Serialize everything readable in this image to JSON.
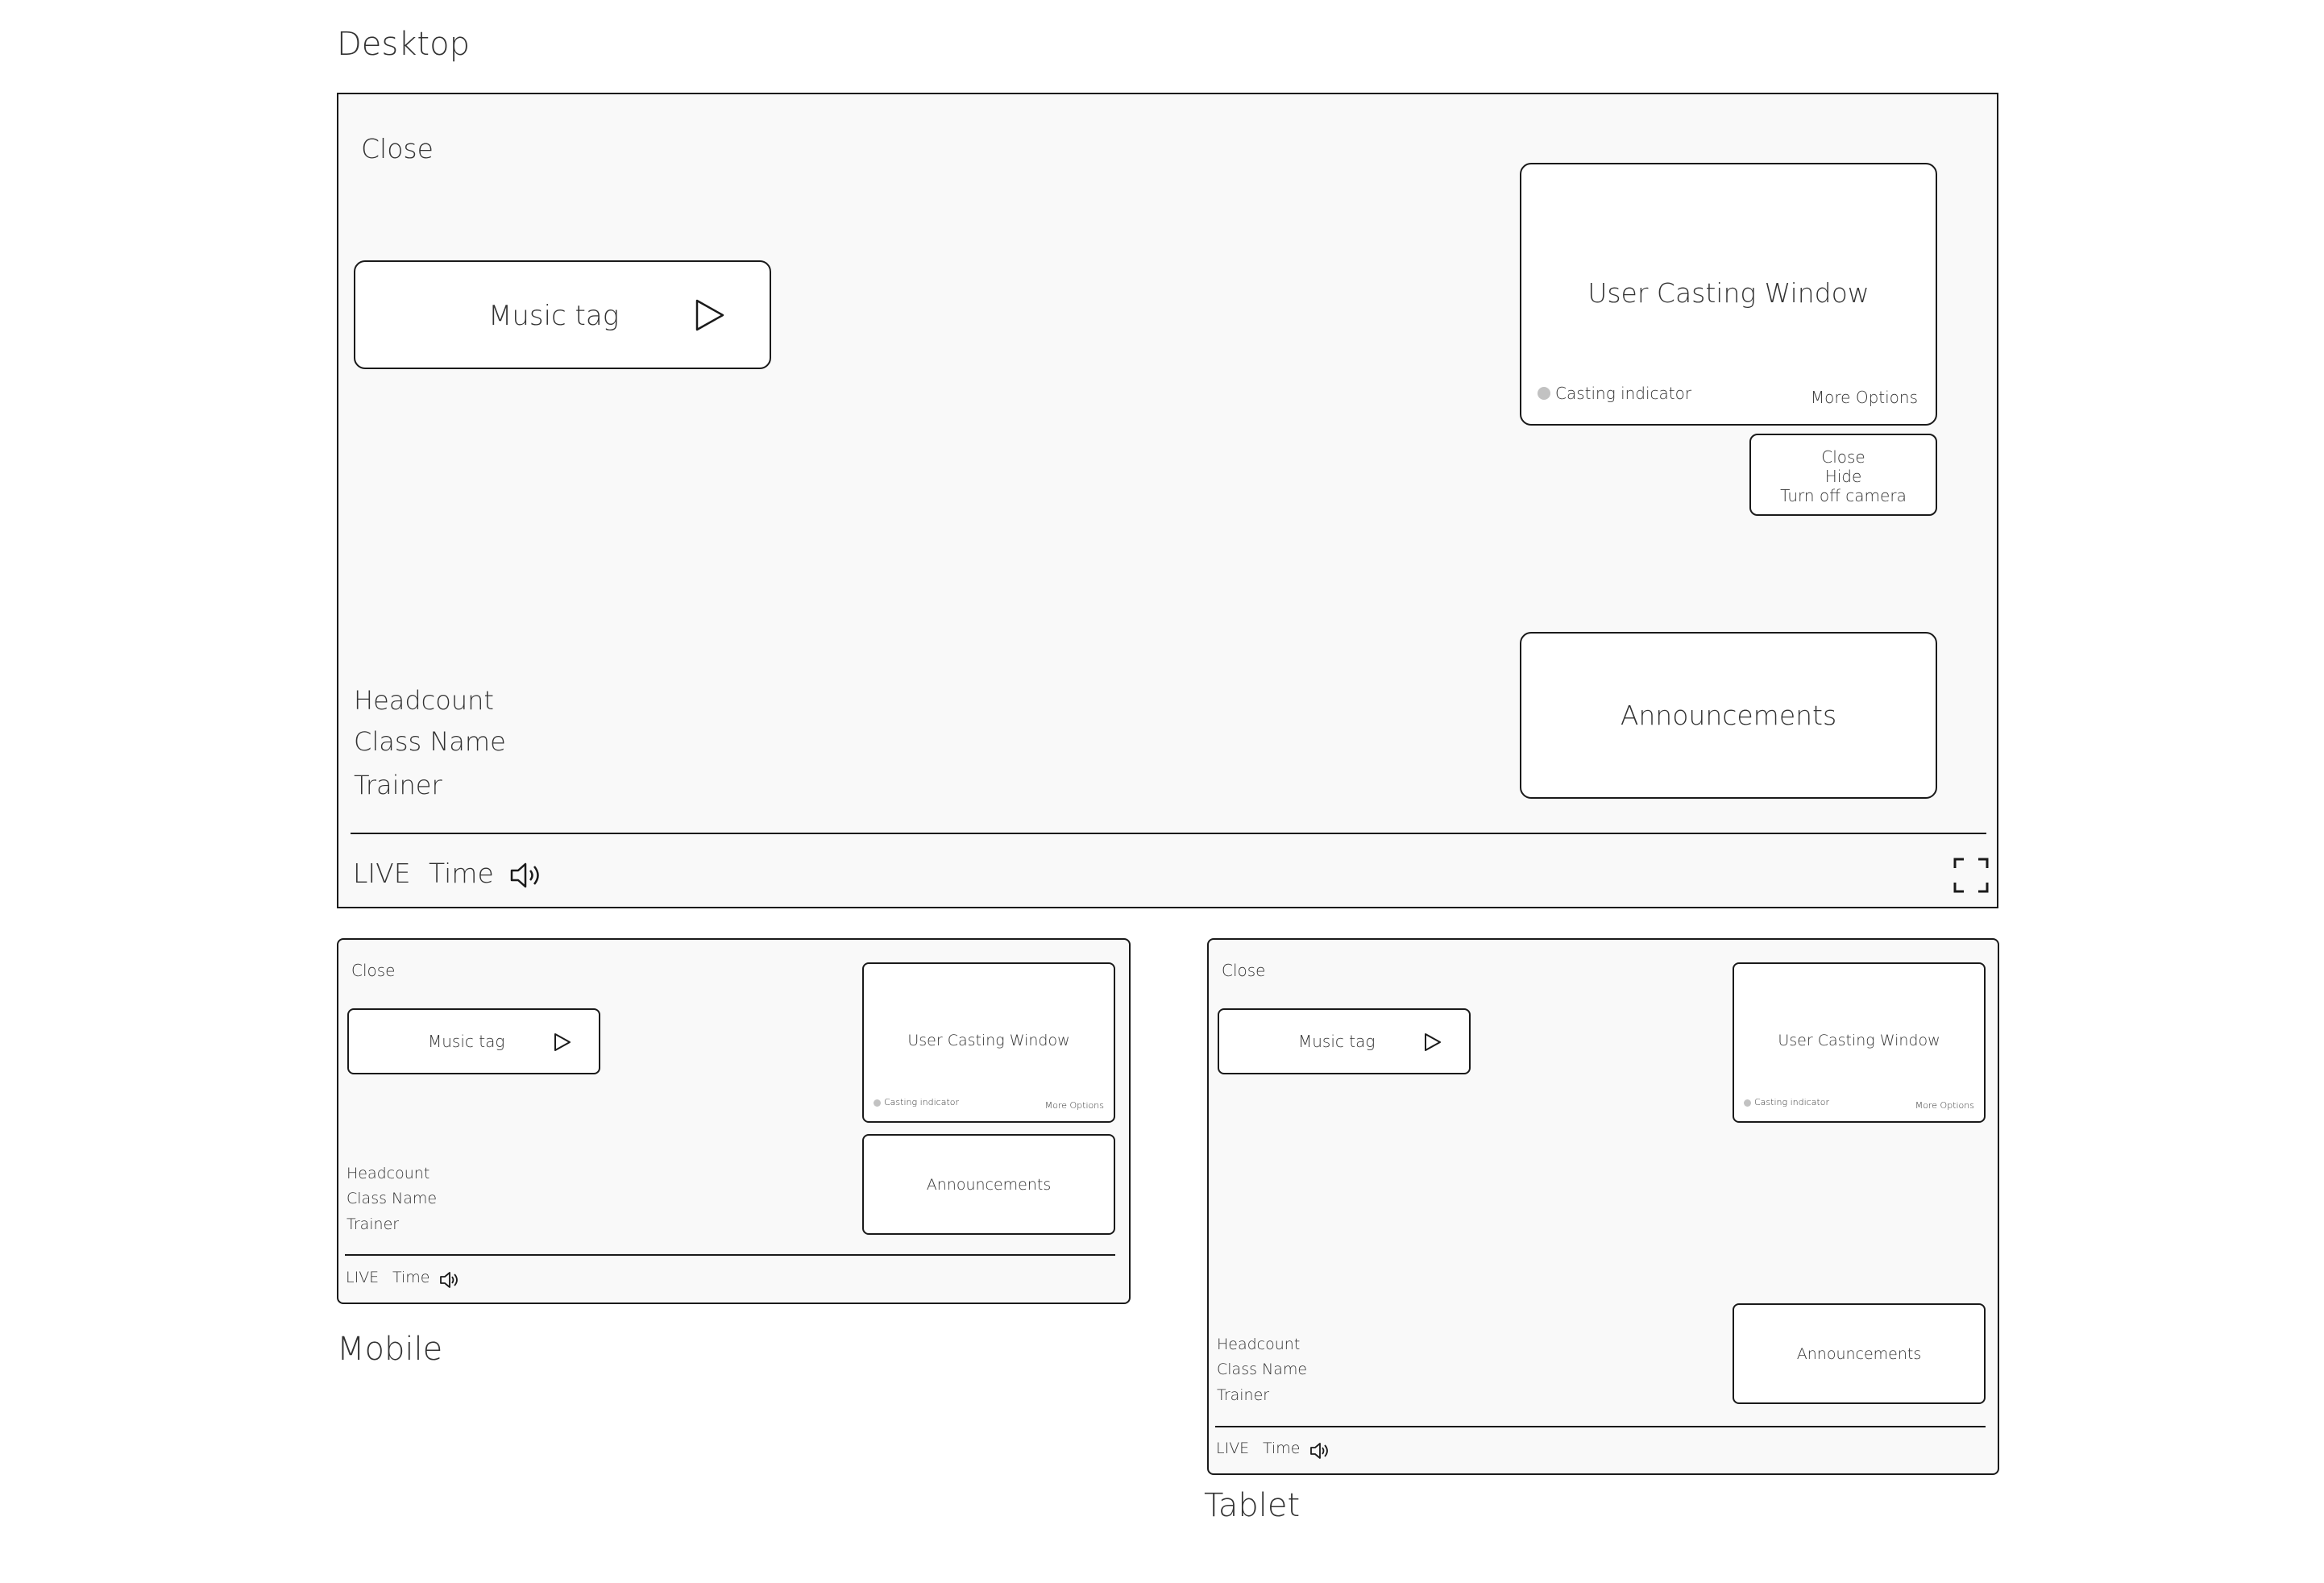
{
  "headings": {
    "desktop": "Desktop",
    "mobile": "Mobile",
    "tablet": "Tablet"
  },
  "player": {
    "close_label": "Close",
    "music_tag_label": "Music tag",
    "casting_window_label": "User Casting Window",
    "casting_indicator_label": "Casting indicator",
    "more_options_label": "More Options",
    "options_menu": {
      "close": "Close",
      "hide": "Hide",
      "turn_off_camera": "Turn off camera"
    },
    "announcements_label": "Announcements",
    "class_info": {
      "headcount": "Headcount",
      "class_name": "Class Name",
      "trainer": "Trainer"
    },
    "controls": {
      "live_label": "LIVE",
      "time_label": "Time"
    }
  },
  "icons": {
    "play": "play-icon",
    "volume": "volume-icon",
    "fullscreen": "fullscreen-icon",
    "casting_dot": "status-dot-icon"
  },
  "colors": {
    "frame_bg": "#f9f9f9",
    "border": "#1a1a1a",
    "indicator": "#c2c2c2"
  }
}
